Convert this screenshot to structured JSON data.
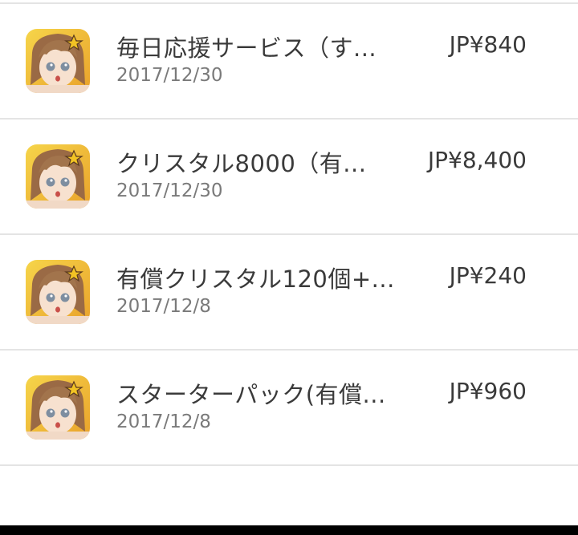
{
  "purchases": [
    {
      "title": "毎日応援サービス（す...",
      "date": "2017/12/30",
      "price": "JP¥840",
      "icon": "game-character-app-icon"
    },
    {
      "title": "クリスタル8000（有...",
      "date": "2017/12/30",
      "price": "JP¥8,400",
      "icon": "game-character-app-icon"
    },
    {
      "title": "有償クリスタル120個+...",
      "date": "2017/12/8",
      "price": "JP¥240",
      "icon": "game-character-app-icon"
    },
    {
      "title": "スターターパック(有償...",
      "date": "2017/12/8",
      "price": "JP¥960",
      "icon": "game-character-app-icon"
    }
  ],
  "colors": {
    "divider": "#e4e4e4",
    "text_primary": "#3a3a3a",
    "text_secondary": "#7a7a7a",
    "nav_bar": "#000000"
  }
}
